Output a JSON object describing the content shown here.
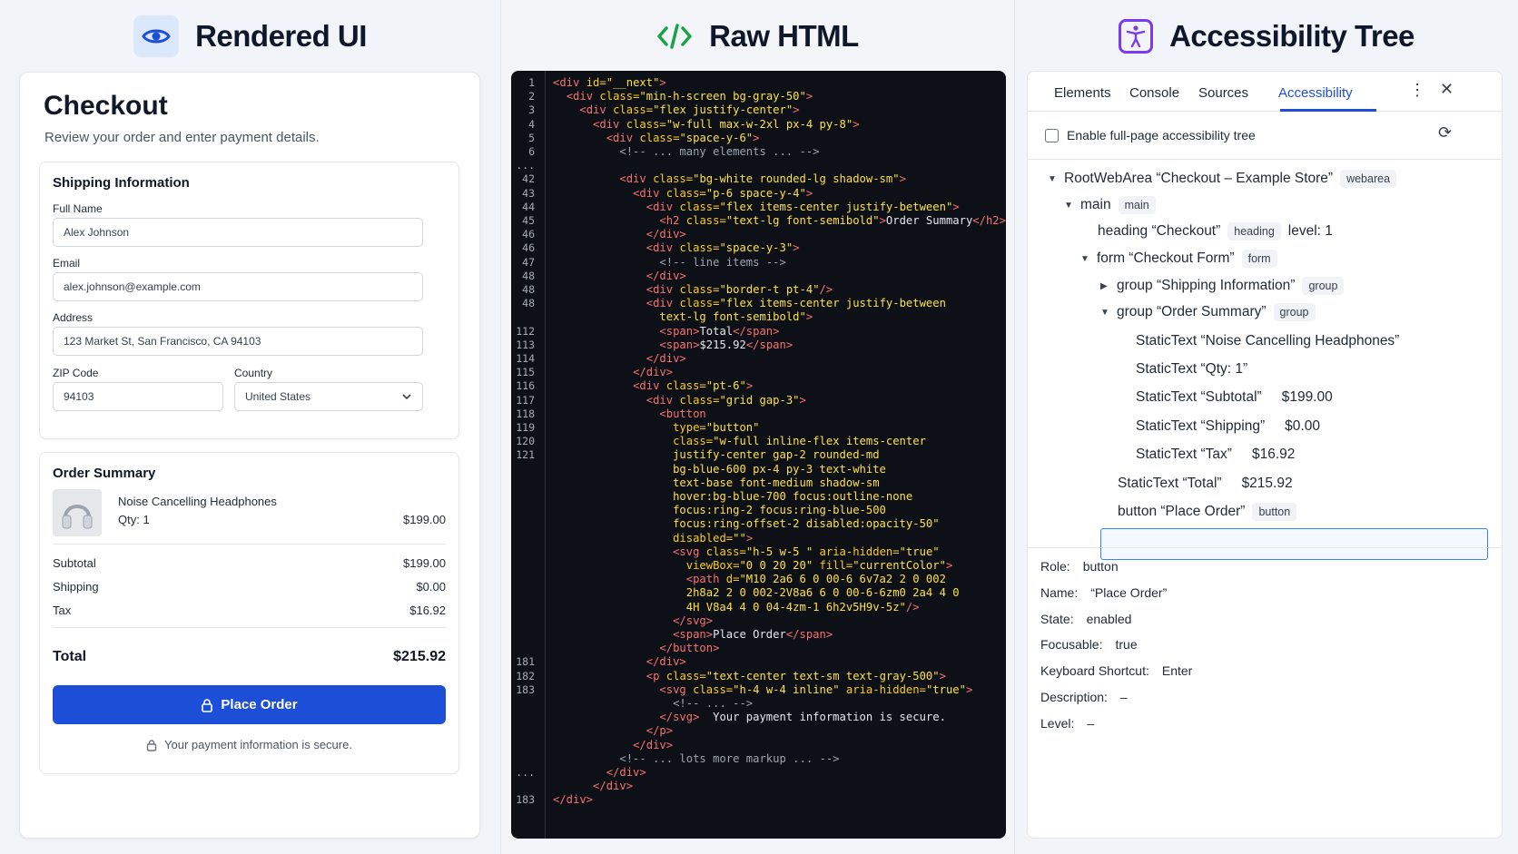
{
  "rendered": {
    "header": "Rendered UI",
    "title": "Checkout",
    "subtitle": "Review your order and enter payment details.",
    "shipping": {
      "title": "Shipping Information",
      "full_name_label": "Full Name",
      "full_name_value": "Alex Johnson",
      "email_label": "Email",
      "email_value": "alex.johnson@example.com",
      "address_label": "Address",
      "address_value": "123 Market St, San Francisco, CA 94103",
      "zip_label": "ZIP Code",
      "zip_value": "94103",
      "country_label": "Country",
      "country_value": "United States"
    },
    "order": {
      "title": "Order Summary",
      "product_name": "Noise Cancelling Headphones",
      "product_qty": "Qty: 1",
      "product_price": "$199.00",
      "subtotal_label": "Subtotal",
      "subtotal_value": "$199.00",
      "shipping_label": "Shipping",
      "shipping_value": "$0.00",
      "tax_label": "Tax",
      "tax_value": "$16.92",
      "total_label": "Total",
      "total_value": "$215.92",
      "button_label": "Place Order",
      "secure_note": "Your payment information is secure."
    },
    "accent": "#1d4ed8"
  },
  "code": {
    "header": "Raw HTML",
    "lines": [
      {
        "n": "1",
        "html": "<span class='t'>&lt;div</span> <span class='a'>id=</span><span class='s'>\"__next\"</span><span class='t'>&gt;</span>"
      },
      {
        "n": "2",
        "html": "  <span class='t'>&lt;div</span> <span class='a'>class=</span><span class='s'>\"min-h-screen bg-gray-50\"</span><span class='t'>&gt;</span>"
      },
      {
        "n": "3",
        "html": "    <span class='t'>&lt;div</span> <span class='a'>class=</span><span class='s'>\"flex justify-center\"</span><span class='t'>&gt;</span>"
      },
      {
        "n": "4",
        "html": "      <span class='t'>&lt;div</span> <span class='a'>class=</span><span class='s'>\"w-full max-w-2xl px-4 py-8\"</span><span class='t'>&gt;</span>"
      },
      {
        "n": "5",
        "html": "        <span class='t'>&lt;div</span> <span class='a'>class=</span><span class='s'>\"space-y-6\"</span><span class='t'>&gt;</span>"
      },
      {
        "n": "6",
        "html": "          <span class='c'>&lt;!-- ... many elements ... --&gt;</span>"
      },
      {
        "n": "...",
        "html": ""
      },
      {
        "n": "42",
        "html": "          <span class='t'>&lt;div</span> <span class='a'>class=</span><span class='s'>\"bg-white rounded-lg shadow-sm\"</span><span class='t'>&gt;</span>"
      },
      {
        "n": "43",
        "html": "            <span class='t'>&lt;div</span> <span class='a'>class=</span><span class='s'>\"p-6 space-y-4\"</span><span class='t'>&gt;</span>"
      },
      {
        "n": "44",
        "html": "              <span class='t'>&lt;div</span> <span class='a'>class=</span><span class='s'>\"flex items-center justify-between\"</span><span class='t'>&gt;</span>"
      },
      {
        "n": "45",
        "html": "                <span class='t'>&lt;h2</span> <span class='a'>class=</span><span class='s'>\"text-lg font-semibold\"</span><span class='t'>&gt;</span>Order Summary<span class='t'>&lt;/h2&gt;</span>"
      },
      {
        "n": "46",
        "html": "              <span class='t'>&lt;/div&gt;</span>"
      },
      {
        "n": "46",
        "html": "              <span class='t'>&lt;div</span> <span class='a'>class=</span><span class='s'>\"space-y-3\"</span><span class='t'>&gt;</span>"
      },
      {
        "n": "47",
        "html": "                <span class='c'>&lt;!-- line items --&gt;</span>"
      },
      {
        "n": "48",
        "html": "              <span class='t'>&lt;/div&gt;</span>"
      },
      {
        "n": "48",
        "html": "              <span class='t'>&lt;div</span> <span class='a'>class=</span><span class='s'>\"border-t pt-4\"</span><span class='t'>/&gt;</span>"
      },
      {
        "n": "48",
        "html": "              <span class='t'>&lt;div</span> <span class='a'>class=</span><span class='s'>\"flex items-center justify-between</span>"
      },
      {
        "n": "",
        "html": "                <span class='s'>text-lg font-semibold\"</span><span class='t'>&gt;</span>"
      },
      {
        "n": "112",
        "html": "                <span class='t'>&lt;span&gt;</span>Total<span class='t'>&lt;/span&gt;</span>"
      },
      {
        "n": "113",
        "html": "                <span class='t'>&lt;span&gt;</span>$215.92<span class='t'>&lt;/span&gt;</span>"
      },
      {
        "n": "114",
        "html": "              <span class='t'>&lt;/div&gt;</span>"
      },
      {
        "n": "115",
        "html": "            <span class='t'>&lt;/div&gt;</span>"
      },
      {
        "n": "116",
        "html": "            <span class='t'>&lt;div</span> <span class='a'>class=</span><span class='s'>\"pt-6\"</span><span class='t'>&gt;</span>"
      },
      {
        "n": "117",
        "html": "              <span class='t'>&lt;div</span> <span class='a'>class=</span><span class='s'>\"grid gap-3\"</span><span class='t'>&gt;</span>"
      },
      {
        "n": "118",
        "html": "                <span class='t'>&lt;button</span>"
      },
      {
        "n": "119",
        "html": "                  <span class='a'>type=</span><span class='s'>\"button\"</span>"
      },
      {
        "n": "120",
        "html": "                  <span class='a'>class=</span><span class='s'>\"w-full inline-flex items-center</span>"
      },
      {
        "n": "121",
        "html": "                  <span class='s'>justify-center gap-2 rounded-md</span>"
      },
      {
        "n": "",
        "html": "                  <span class='s'>bg-blue-600 px-4 py-3 text-white</span>"
      },
      {
        "n": "",
        "html": "                  <span class='s'>text-base font-medium shadow-sm</span>"
      },
      {
        "n": "",
        "html": "                  <span class='s'>hover:bg-blue-700 focus:outline-none</span>"
      },
      {
        "n": "",
        "html": "                  <span class='s'>focus:ring-2 focus:ring-blue-500</span>"
      },
      {
        "n": "",
        "html": "                  <span class='s'>focus:ring-offset-2 disabled:opacity-50\"</span>"
      },
      {
        "n": "",
        "html": "                  <span class='a'>disabled=</span><span class='s'>\"\"</span><span class='t'>&gt;</span>"
      },
      {
        "n": "",
        "html": "                  <span class='t'>&lt;svg</span> <span class='a'>class=</span><span class='s'>\"h-5 w-5 \"</span> <span class='a'>aria-hidden=</span><span class='s'>\"true\"</span>"
      },
      {
        "n": "",
        "html": "                    <span class='a'>viewBox=</span><span class='s'>\"0 0 20 20\"</span> <span class='a'>fill=</span><span class='s'>\"currentColor\"</span><span class='t'>&gt;</span>"
      },
      {
        "n": "",
        "html": "                    <span class='t'>&lt;path</span> <span class='a'>d=</span><span class='s'>\"M10 2a6 6 0 00-6 6v7a2 2 0 002</span>"
      },
      {
        "n": "",
        "html": "                    <span class='s'>2h8a2 2 0 002-2V8a6 6 0 00-6-6zm0 2a4 4 0</span>"
      },
      {
        "n": "",
        "html": "                    <span class='s'>4H V8a4 4 0 04-4zm-1 6h2v5H9v-5z\"</span><span class='t'>/&gt;</span>"
      },
      {
        "n": "",
        "html": "                  <span class='t'>&lt;/svg&gt;</span>"
      },
      {
        "n": "",
        "html": "                  <span class='t'>&lt;span&gt;</span>Place Order<span class='t'>&lt;/span&gt;</span>"
      },
      {
        "n": "",
        "html": "                <span class='t'>&lt;/button&gt;</span>"
      },
      {
        "n": "181",
        "html": "              <span class='t'>&lt;/div&gt;</span>"
      },
      {
        "n": "182",
        "html": "              <span class='t'>&lt;p</span> <span class='a'>class=</span><span class='s'>\"text-center text-sm text-gray-500\"</span><span class='t'>&gt;</span>"
      },
      {
        "n": "183",
        "html": "                <span class='t'>&lt;svg</span> <span class='a'>class=</span><span class='s'>\"h-4 w-4 inline\"</span> <span class='a'>aria-hidden=</span><span class='s'>\"true\"</span><span class='t'>&gt;</span>"
      },
      {
        "n": "",
        "html": "                  <span class='c'>&lt;!-- ... --&gt;</span>"
      },
      {
        "n": "",
        "html": "                <span class='t'>&lt;/svg&gt;</span>  Your payment information is secure."
      },
      {
        "n": "",
        "html": "              <span class='t'>&lt;/p&gt;</span>"
      },
      {
        "n": "",
        "html": "            <span class='t'>&lt;/div&gt;</span>"
      },
      {
        "n": "",
        "html": "          <span class='c'>&lt;!-- ... lots more markup ... --&gt;</span>"
      },
      {
        "n": "...",
        "html": "        <span class='t'>&lt;/div&gt;</span>"
      },
      {
        "n": "",
        "html": "      <span class='t'>&lt;/div&gt;</span>"
      },
      {
        "n": "183",
        "html": "<span class='t'>&lt;/div&gt;</span>"
      }
    ]
  },
  "a11y": {
    "header": "Accessibility Tree",
    "tabs": [
      "Elements",
      "Console",
      "Sources",
      "Accessibility"
    ],
    "enable_label": "Enable full-page accessibility tree",
    "tree": {
      "root_name": "RootWebArea “Checkout – Example Store”",
      "root_tag": "webarea",
      "main_name": "main",
      "main_tag": "main",
      "heading_name": "heading “Checkout”",
      "heading_tag": "heading",
      "heading_level": "level: 1",
      "form_name": "form “Checkout Form”",
      "form_tag": "form",
      "group1_name": "group “Shipping Information”",
      "group1_tag": "group",
      "group2_name": "group “Order Summary”",
      "group2_tag": "group",
      "st1": "StaticText “Noise Cancelling Headphones”",
      "st2": "StaticText “Qty: 1”",
      "st3": "StaticText “Subtotal”",
      "st3_val": "$199.00",
      "st4": "StaticText “Shipping”",
      "st4_val": "$0.00",
      "st5": "StaticText “Tax”",
      "st5_val": "$16.92",
      "st6": "StaticText “Total”",
      "st6_val": "$215.92",
      "button_name": "button “Place Order”",
      "button_tag": "button"
    },
    "props": {
      "role_label": "Role:",
      "role_value": "button",
      "name_label": "Name:",
      "name_value": "“Place Order”",
      "state_label": "State:",
      "state_value": "enabled",
      "focusable_label": "Focusable:",
      "focusable_value": "true",
      "shortcut_label": "Keyboard Shortcut:",
      "shortcut_value": "Enter",
      "desc_label": "Description:",
      "desc_value": "–",
      "level_label": "Level:",
      "level_value": "–"
    },
    "icons": [
      "more-vertical-icon",
      "close-icon",
      "refresh-icon"
    ],
    "highlight_color": "#3b82f6"
  }
}
